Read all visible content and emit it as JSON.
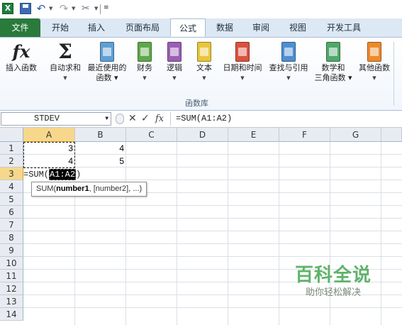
{
  "quick_access": {
    "excel_logo": "X",
    "more": "≡"
  },
  "tabs": [
    "文件",
    "开始",
    "插入",
    "页面布局",
    "公式",
    "数据",
    "审阅",
    "视图",
    "开发工具"
  ],
  "active_tab": "公式",
  "ribbon": {
    "buttons": [
      {
        "line1": "插入函数",
        "line2": "",
        "has_arrow": false,
        "icon": "fx-icon"
      },
      {
        "line1": "自动求和",
        "line2": "",
        "has_arrow": true,
        "icon": "sigma-icon"
      },
      {
        "line1": "最近使用的",
        "line2": "函数",
        "has_arrow": true,
        "icon": "star-book-icon"
      },
      {
        "line1": "财务",
        "line2": "",
        "has_arrow": true,
        "icon": "finance-book-icon"
      },
      {
        "line1": "逻辑",
        "line2": "",
        "has_arrow": true,
        "icon": "logic-book-icon"
      },
      {
        "line1": "文本",
        "line2": "",
        "has_arrow": true,
        "icon": "text-book-icon"
      },
      {
        "line1": "日期和时间",
        "line2": "",
        "has_arrow": true,
        "icon": "datetime-book-icon"
      },
      {
        "line1": "查找与引用",
        "line2": "",
        "has_arrow": true,
        "icon": "lookup-book-icon"
      },
      {
        "line1": "数学和",
        "line2": "三角函数",
        "has_arrow": true,
        "icon": "math-book-icon"
      },
      {
        "line1": "其他函数",
        "line2": "",
        "has_arrow": true,
        "icon": "other-book-icon"
      }
    ],
    "group_label": "函数库"
  },
  "formula_bar": {
    "name_box": "STDEV",
    "cancel": "✕",
    "enter": "✓",
    "fx": "fx",
    "formula": "=SUM(A1:A2)"
  },
  "sheet": {
    "columns": [
      "A",
      "B",
      "C",
      "D",
      "E",
      "F",
      "G"
    ],
    "rows": [
      "1",
      "2",
      "3",
      "4",
      "5",
      "6",
      "7",
      "8",
      "9",
      "10",
      "11",
      "12",
      "13",
      "14"
    ],
    "cells": {
      "A1": "3",
      "B1": "4",
      "A2": "4",
      "B2": "5"
    },
    "edit_cell": {
      "prefix": "=SUM(",
      "ref": "A1:A2",
      "suffix": ")"
    },
    "tooltip": {
      "func": "SUM(",
      "arg1": "number1",
      "rest": ", [number2], ...)"
    }
  },
  "watermark": {
    "title": "百科全说",
    "subtitle": "助你轻松解决"
  },
  "colors": {
    "file_tab": "#2a7a3b",
    "selected_header": "#f7d78b",
    "watermark": "#5fb36a"
  }
}
